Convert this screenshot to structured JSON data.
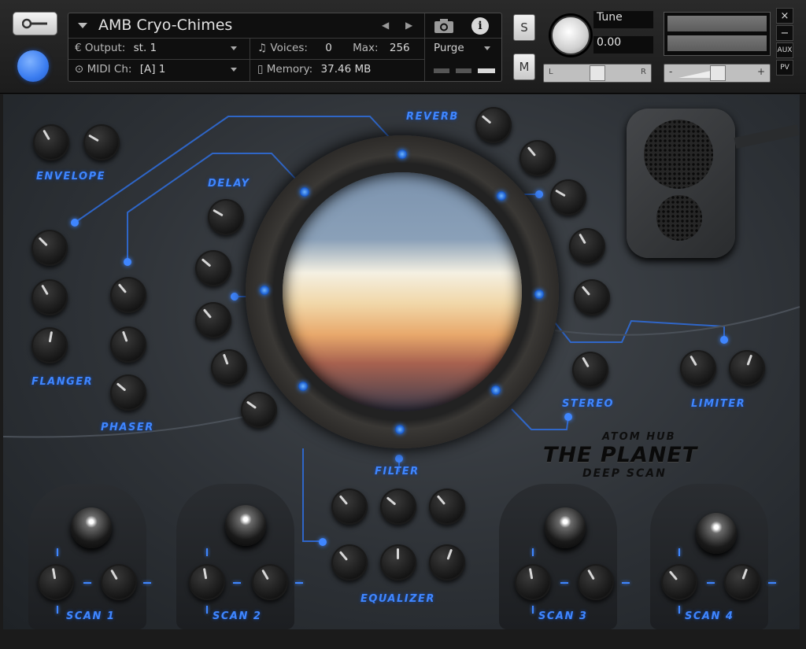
{
  "header": {
    "instrument_name": "AMB Cryo-Chimes",
    "output_label": "Output:",
    "output_value": "st. 1",
    "midi_label": "MIDI Ch:",
    "midi_value": "[A]  1",
    "voices_label": "Voices:",
    "voices_value": "0",
    "max_label": "Max:",
    "max_value": "256",
    "memory_label": "Memory:",
    "memory_value": "37.46 MB",
    "purge_label": "Purge",
    "solo_label": "S",
    "mute_label": "M",
    "tune_label": "Tune",
    "tune_value": "0.00",
    "pan_left": "L",
    "pan_right": "R",
    "vol_minus": "-",
    "vol_plus": "+",
    "win_close": "×",
    "win_min": "−",
    "aux_label": "AUX",
    "pv_label": "PV"
  },
  "panel": {
    "labels": {
      "envelope": "ENVELOPE",
      "delay": "DELAY",
      "reverb": "REVERB",
      "flanger": "FLANGER",
      "phaser": "PHASER",
      "stereo": "STEREO",
      "limiter": "LIMITER",
      "filter": "FILTER",
      "equalizer": "EQUALIZER",
      "scan1": "SCAN 1",
      "scan2": "SCAN 2",
      "scan3": "SCAN 3",
      "scan4": "SCAN 4"
    },
    "logo": {
      "brand": "ATOM HUB",
      "title": "THE PLANET",
      "subtitle": "DEEP SCAN"
    }
  },
  "icons": {
    "wrench": "wrench-icon",
    "camera": "camera-icon",
    "info": "info-icon",
    "output": "output-icon",
    "midi": "midi-icon",
    "voices": "voices-icon",
    "memory": "memory-icon"
  },
  "colors": {
    "accent_blue": "#3f86ff",
    "led_blue": "#3a7cf0"
  }
}
